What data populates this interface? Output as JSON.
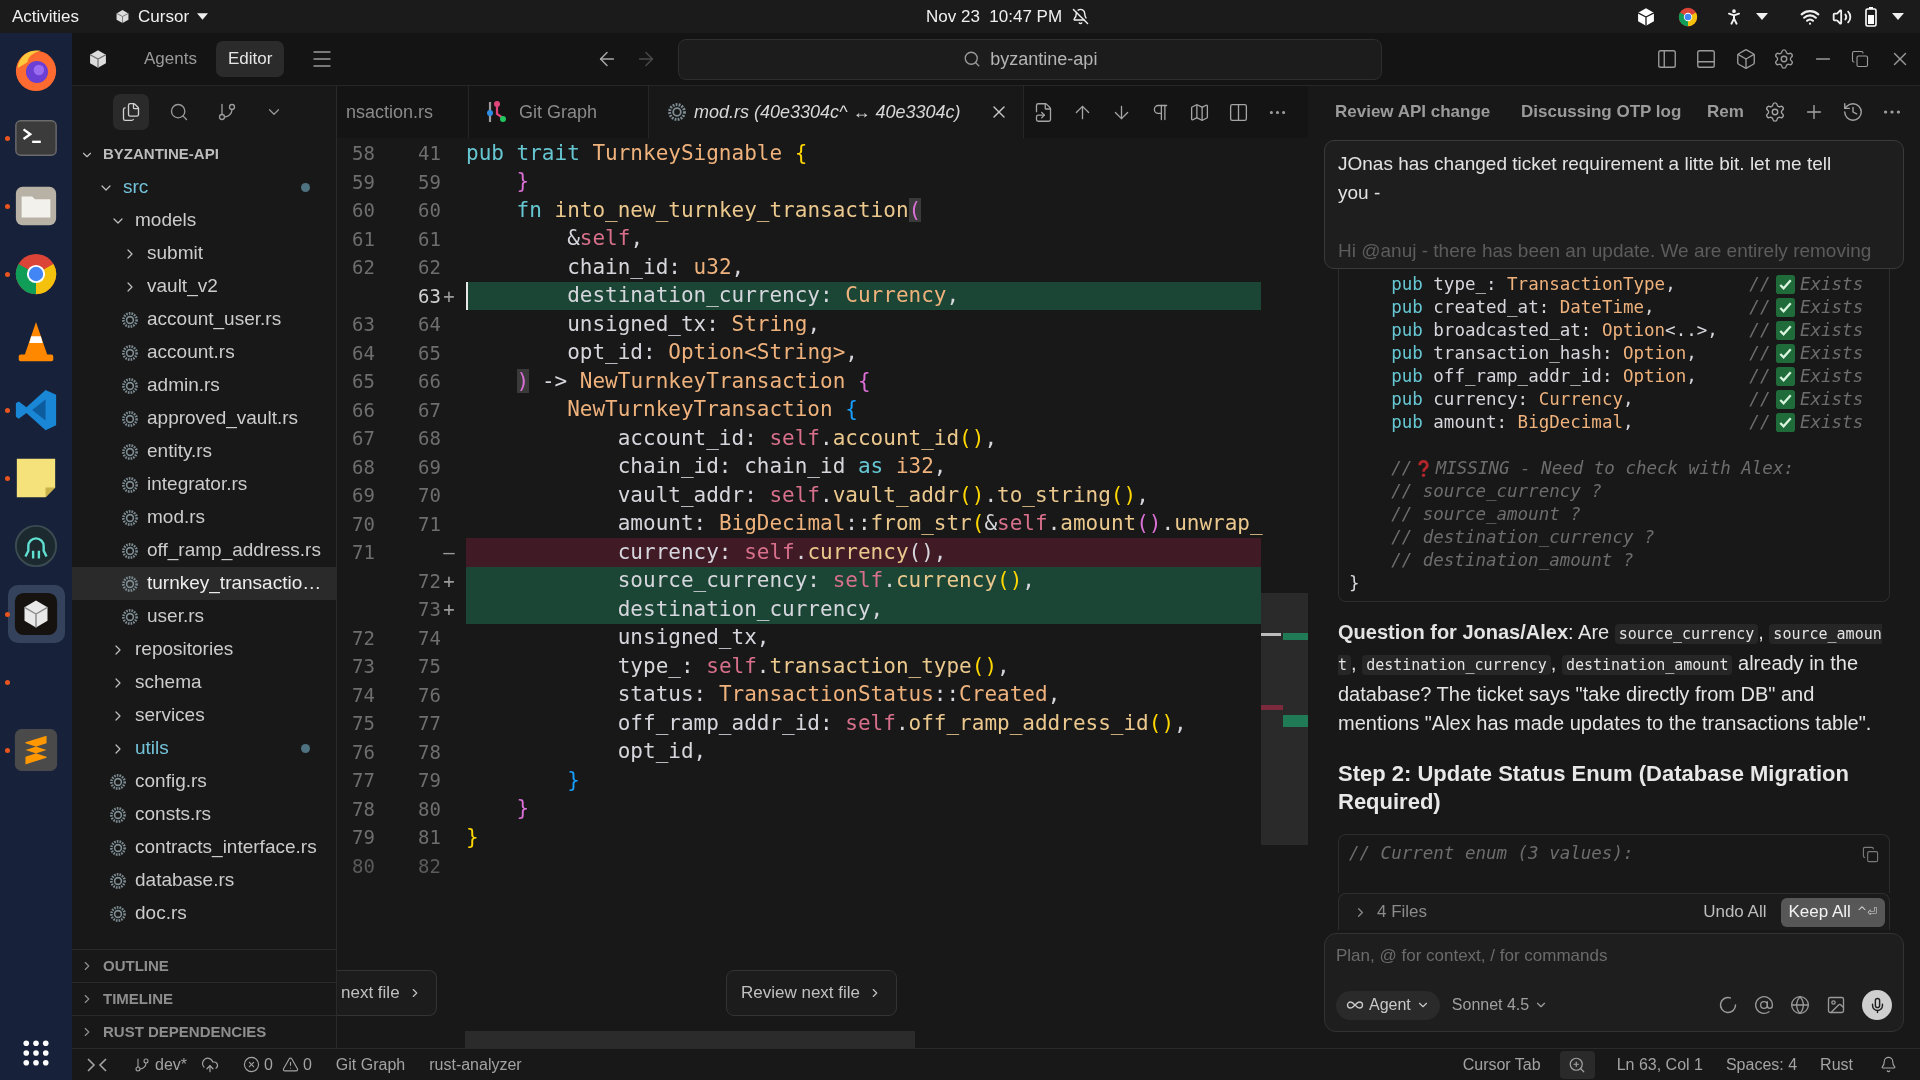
{
  "top_bar": {
    "activities": "Activities",
    "app_menu": "Cursor",
    "clock": "Nov 23  10:47 PM"
  },
  "dock": [
    {
      "kind": "firefox",
      "running": false,
      "selected": false
    },
    {
      "kind": "terminal",
      "running": true,
      "selected": false
    },
    {
      "kind": "files",
      "running": true,
      "selected": false
    },
    {
      "kind": "chrome",
      "running": true,
      "selected": false
    },
    {
      "kind": "vlc",
      "running": false,
      "selected": false
    },
    {
      "kind": "vscode",
      "running": true,
      "selected": false
    },
    {
      "kind": "notes",
      "running": true,
      "selected": false
    },
    {
      "kind": "gitkraken",
      "running": false,
      "selected": false
    },
    {
      "kind": "cursor",
      "running": true,
      "selected": true
    },
    {
      "kind": "blank",
      "running": true,
      "selected": false
    },
    {
      "kind": "sublime",
      "running": true,
      "selected": false
    }
  ],
  "title_bar": {
    "modes": [
      {
        "label": "Agents",
        "selected": false
      },
      {
        "label": "Editor",
        "selected": true
      }
    ],
    "nav": [
      {
        "kind": "back",
        "disabled": false
      },
      {
        "kind": "forward",
        "disabled": true
      }
    ],
    "command_center": {
      "value": "byzantine-api"
    }
  },
  "explorer": {
    "views": [
      {
        "kind": "files",
        "selected": true
      },
      {
        "kind": "search",
        "selected": false
      },
      {
        "kind": "source_control",
        "selected": false
      }
    ],
    "root": {
      "label": "BYZANTINE-API",
      "expanded": true
    },
    "tree": [
      {
        "kind": "folder",
        "label": "src",
        "expanded": true,
        "modified": true,
        "selected": false,
        "children": [
          {
            "kind": "folder",
            "label": "models",
            "expanded": true,
            "modified": false,
            "selected": false,
            "children": [
              {
                "kind": "folder",
                "label": "submit",
                "expanded": false,
                "modified": false,
                "selected": false
              },
              {
                "kind": "folder",
                "label": "vault_v2",
                "expanded": false,
                "modified": false,
                "selected": false
              },
              {
                "kind": "file",
                "label": "account_user.rs",
                "modified": false,
                "selected": false
              },
              {
                "kind": "file",
                "label": "account.rs",
                "modified": false,
                "selected": false
              },
              {
                "kind": "file",
                "label": "admin.rs",
                "modified": false,
                "selected": false
              },
              {
                "kind": "file",
                "label": "approved_vault.rs",
                "modified": false,
                "selected": false
              },
              {
                "kind": "file",
                "label": "entity.rs",
                "modified": false,
                "selected": false
              },
              {
                "kind": "file",
                "label": "integrator.rs",
                "modified": false,
                "selected": false
              },
              {
                "kind": "file",
                "label": "mod.rs",
                "modified": false,
                "selected": false
              },
              {
                "kind": "file",
                "label": "off_ramp_address.rs",
                "modified": false,
                "selected": false
              },
              {
                "kind": "file",
                "label": "turnkey_transactio…",
                "modified": false,
                "selected": true
              },
              {
                "kind": "file",
                "label": "user.rs",
                "modified": false,
                "selected": false
              }
            ]
          },
          {
            "kind": "folder",
            "label": "repositories",
            "expanded": false,
            "modified": false,
            "selected": false
          },
          {
            "kind": "folder",
            "label": "schema",
            "expanded": false,
            "modified": false,
            "selected": false
          },
          {
            "kind": "folder",
            "label": "services",
            "expanded": false,
            "modified": false,
            "selected": false
          },
          {
            "kind": "folder",
            "label": "utils",
            "expanded": false,
            "modified": true,
            "selected": false
          },
          {
            "kind": "file",
            "label": "config.rs",
            "modified": false,
            "selected": false
          },
          {
            "kind": "file",
            "label": "consts.rs",
            "modified": false,
            "selected": false
          },
          {
            "kind": "file",
            "label": "contracts_interface.rs",
            "modified": false,
            "selected": false
          },
          {
            "kind": "file",
            "label": "database.rs",
            "modified": false,
            "selected": false
          },
          {
            "kind": "file",
            "label": "doc.rs",
            "modified": false,
            "selected": false
          }
        ]
      }
    ],
    "sections": [
      {
        "label": "OUTLINE",
        "expanded": false
      },
      {
        "label": "TIMELINE",
        "expanded": false
      },
      {
        "label": "RUST DEPENDENCIES",
        "expanded": false
      }
    ]
  },
  "editor": {
    "tabs": [
      {
        "label": "nsaction.rs",
        "kind": "clipped",
        "selected": false
      },
      {
        "label": "Git Graph",
        "kind": "graph",
        "selected": false
      },
      {
        "label": "mod.rs (40e3304c^ ↔ 40e3304c)",
        "kind": "diff",
        "selected": true
      }
    ],
    "lines": [
      {
        "old": "58",
        "new": "41",
        "kind": "context",
        "current": false,
        "code": [
          {
            "text": "pub trait ",
            "kind": "kw"
          },
          {
            "text": "TurnkeySignable ",
            "kind": "ty"
          },
          {
            "text": "{",
            "kind": "y"
          }
        ]
      },
      {
        "old": "59",
        "new": "59",
        "kind": "context",
        "current": false,
        "code": [
          {
            "text": "    }",
            "kind": "m"
          }
        ]
      },
      {
        "old": "60",
        "new": "60",
        "kind": "context",
        "current": false,
        "code": [
          {
            "text": "    fn ",
            "kind": "kw"
          },
          {
            "text": "into_new_turnkey_transaction",
            "kind": "fn"
          },
          {
            "text": "(",
            "kind": "mb"
          }
        ]
      },
      {
        "old": "61",
        "new": "61",
        "kind": "context",
        "current": false,
        "code": [
          {
            "text": "        &",
            "kind": "p"
          },
          {
            "text": "self",
            "kind": "sf"
          },
          {
            "text": ",",
            "kind": "p"
          }
        ]
      },
      {
        "old": "62",
        "new": "62",
        "kind": "context",
        "current": false,
        "code": [
          {
            "text": "        chain_id: ",
            "kind": "p"
          },
          {
            "text": "u32",
            "kind": "ty"
          },
          {
            "text": ",",
            "kind": "p"
          }
        ]
      },
      {
        "new": "63",
        "marker": "+",
        "kind": "added",
        "current": true,
        "code": [
          {
            "text": "        destination_currency: ",
            "kind": "p"
          },
          {
            "text": "Currency",
            "kind": "ty"
          },
          {
            "text": ",",
            "kind": "p"
          }
        ]
      },
      {
        "old": "63",
        "new": "64",
        "kind": "context",
        "current": false,
        "code": [
          {
            "text": "        unsigned_tx: ",
            "kind": "p"
          },
          {
            "text": "String",
            "kind": "ty"
          },
          {
            "text": ",",
            "kind": "p"
          }
        ]
      },
      {
        "old": "64",
        "new": "65",
        "kind": "context",
        "current": false,
        "code": [
          {
            "text": "        opt_id: ",
            "kind": "p"
          },
          {
            "text": "Option<String>",
            "kind": "ty"
          },
          {
            "text": ",",
            "kind": "p"
          }
        ]
      },
      {
        "old": "65",
        "new": "66",
        "kind": "context",
        "current": false,
        "code": [
          {
            "text": "    )",
            "kind": "mb"
          },
          {
            "text": " -> ",
            "kind": "p"
          },
          {
            "text": "NewTurnkeyTransaction ",
            "kind": "ty"
          },
          {
            "text": "{",
            "kind": "m"
          }
        ]
      },
      {
        "old": "66",
        "new": "67",
        "kind": "context",
        "current": false,
        "code": [
          {
            "text": "        NewTurnkeyTransaction ",
            "kind": "ty"
          },
          {
            "text": "{",
            "kind": "b"
          }
        ]
      },
      {
        "old": "67",
        "new": "68",
        "kind": "context",
        "current": false,
        "code": [
          {
            "text": "            account_id: ",
            "kind": "p"
          },
          {
            "text": "self",
            "kind": "sf"
          },
          {
            "text": ".",
            "kind": "p"
          },
          {
            "text": "account_id",
            "kind": "fn"
          },
          {
            "text": "()",
            "kind": "y"
          },
          {
            "text": ",",
            "kind": "p"
          }
        ]
      },
      {
        "old": "68",
        "new": "69",
        "kind": "context",
        "current": false,
        "code": [
          {
            "text": "            chain_id: chain_id ",
            "kind": "p"
          },
          {
            "text": "as ",
            "kind": "kw"
          },
          {
            "text": "i32",
            "kind": "ty"
          },
          {
            "text": ",",
            "kind": "p"
          }
        ]
      },
      {
        "old": "69",
        "new": "70",
        "kind": "context",
        "current": false,
        "code": [
          {
            "text": "            vault_addr: ",
            "kind": "p"
          },
          {
            "text": "self",
            "kind": "sf"
          },
          {
            "text": ".",
            "kind": "p"
          },
          {
            "text": "vault_addr",
            "kind": "fn"
          },
          {
            "text": "()",
            "kind": "y"
          },
          {
            "text": ".",
            "kind": "p"
          },
          {
            "text": "to_string",
            "kind": "fn"
          },
          {
            "text": "()",
            "kind": "y"
          },
          {
            "text": ",",
            "kind": "p"
          }
        ]
      },
      {
        "old": "70",
        "new": "71",
        "kind": "context",
        "current": false,
        "code": [
          {
            "text": "            amount: ",
            "kind": "p"
          },
          {
            "text": "BigDecimal",
            "kind": "ty"
          },
          {
            "text": "::",
            "kind": "p"
          },
          {
            "text": "from_str",
            "kind": "fn"
          },
          {
            "text": "(",
            "kind": "y"
          },
          {
            "text": "&",
            "kind": "p"
          },
          {
            "text": "self",
            "kind": "sf"
          },
          {
            "text": ".",
            "kind": "p"
          },
          {
            "text": "amount",
            "kind": "fn"
          },
          {
            "text": "()",
            "kind": "m"
          },
          {
            "text": ".",
            "kind": "p"
          },
          {
            "text": "unwrap_",
            "kind": "fn"
          }
        ]
      },
      {
        "old": "71",
        "marker": "—",
        "kind": "removed",
        "current": false,
        "code": [
          {
            "text": "            currency: ",
            "kind": "p"
          },
          {
            "text": "self",
            "kind": "sf"
          },
          {
            "text": ".",
            "kind": "p"
          },
          {
            "text": "currency",
            "kind": "fn"
          },
          {
            "text": "(),",
            "kind": "p"
          }
        ]
      },
      {
        "new": "72",
        "marker": "+",
        "kind": "added",
        "current": false,
        "code": [
          {
            "text": "            source_currency: ",
            "kind": "p"
          },
          {
            "text": "self",
            "kind": "sf"
          },
          {
            "text": ".",
            "kind": "p"
          },
          {
            "text": "currency",
            "kind": "fn"
          },
          {
            "text": "()",
            "kind": "y"
          },
          {
            "text": ",",
            "kind": "p"
          }
        ]
      },
      {
        "new": "73",
        "marker": "+",
        "kind": "added",
        "current": false,
        "code": [
          {
            "text": "            destination_currency,",
            "kind": "p"
          }
        ]
      },
      {
        "old": "72",
        "new": "74",
        "kind": "context",
        "current": false,
        "code": [
          {
            "text": "            unsigned_tx,",
            "kind": "p"
          }
        ]
      },
      {
        "old": "73",
        "new": "75",
        "kind": "context",
        "current": false,
        "code": [
          {
            "text": "            type_: ",
            "kind": "p"
          },
          {
            "text": "self",
            "kind": "sf"
          },
          {
            "text": ".",
            "kind": "p"
          },
          {
            "text": "transaction_type",
            "kind": "fn"
          },
          {
            "text": "()",
            "kind": "y"
          },
          {
            "text": ",",
            "kind": "p"
          }
        ]
      },
      {
        "old": "74",
        "new": "76",
        "kind": "context",
        "current": false,
        "code": [
          {
            "text": "            status: ",
            "kind": "p"
          },
          {
            "text": "TransactionStatus",
            "kind": "ty"
          },
          {
            "text": "::",
            "kind": "p"
          },
          {
            "text": "Created",
            "kind": "ty"
          },
          {
            "text": ",",
            "kind": "p"
          }
        ]
      },
      {
        "old": "75",
        "new": "77",
        "kind": "context",
        "current": false,
        "code": [
          {
            "text": "            off_ramp_addr_id: ",
            "kind": "p"
          },
          {
            "text": "self",
            "kind": "sf"
          },
          {
            "text": ".",
            "kind": "p"
          },
          {
            "text": "off_ramp_address_id",
            "kind": "fn"
          },
          {
            "text": "()",
            "kind": "y"
          },
          {
            "text": ",",
            "kind": "p"
          }
        ]
      },
      {
        "old": "76",
        "new": "78",
        "kind": "context",
        "current": false,
        "code": [
          {
            "text": "            opt_id,",
            "kind": "p"
          }
        ]
      },
      {
        "old": "77",
        "new": "79",
        "kind": "context",
        "current": false,
        "code": [
          {
            "text": "        }",
            "kind": "b"
          }
        ]
      },
      {
        "old": "78",
        "new": "80",
        "kind": "context",
        "current": false,
        "code": [
          {
            "text": "    }",
            "kind": "m"
          }
        ]
      },
      {
        "old": "79",
        "new": "81",
        "kind": "context",
        "current": false,
        "code": [
          {
            "text": "}",
            "kind": "y"
          }
        ]
      },
      {
        "old": "80",
        "new": "82",
        "kind": "faded",
        "current": false
      }
    ],
    "buttons": [
      {
        "label": "next file"
      },
      {
        "label": "Review next file"
      }
    ]
  },
  "chat": {
    "tabs": [
      {
        "label": "Review API change",
        "selected": false
      },
      {
        "label": "Discussing OTP log",
        "selected": false
      },
      {
        "label": "Rem",
        "selected": false
      }
    ],
    "message": {
      "paragraphs": [
        {
          "text": "JOnas has changed ticket requirement a litte bit. let me tell you -",
          "cut": false
        },
        {
          "text": "Hi @anuj - there has been an update. We are entirely removing",
          "cut": true
        }
      ]
    },
    "code_block": {
      "lines": [
        {
          "kind": "checked",
          "code": [
            {
              "text": "    pub ",
              "kind": "kw"
            },
            {
              "text": "type_: ",
              "kind": "p"
            },
            {
              "text": "TransactionType",
              "kind": "ty"
            },
            {
              "text": ",",
              "kind": "p"
            }
          ],
          "prefix": "//",
          "note": "Exists"
        },
        {
          "kind": "checked",
          "code": [
            {
              "text": "    pub ",
              "kind": "kw"
            },
            {
              "text": "created_at: ",
              "kind": "p"
            },
            {
              "text": "DateTime",
              "kind": "ty"
            },
            {
              "text": ",",
              "kind": "p"
            }
          ],
          "prefix": "//",
          "note": "Exists"
        },
        {
          "kind": "checked",
          "code": [
            {
              "text": "    pub ",
              "kind": "kw"
            },
            {
              "text": "broadcasted_at: ",
              "kind": "p"
            },
            {
              "text": "Option",
              "kind": "ty"
            },
            {
              "text": "<..>,",
              "kind": "p"
            }
          ],
          "prefix": "//",
          "note": "Exists"
        },
        {
          "kind": "checked",
          "code": [
            {
              "text": "    pub ",
              "kind": "kw"
            },
            {
              "text": "transaction_hash: ",
              "kind": "p"
            },
            {
              "text": "Option",
              "kind": "ty"
            },
            {
              "text": ",",
              "kind": "p"
            }
          ],
          "prefix": "//",
          "note": "Exists"
        },
        {
          "kind": "checked",
          "code": [
            {
              "text": "    pub ",
              "kind": "kw"
            },
            {
              "text": "off_ramp_addr_id: ",
              "kind": "p"
            },
            {
              "text": "Option",
              "kind": "ty"
            },
            {
              "text": ",",
              "kind": "p"
            }
          ],
          "prefix": "//",
          "note": "Exists"
        },
        {
          "kind": "checked",
          "code": [
            {
              "text": "    pub ",
              "kind": "kw"
            },
            {
              "text": "currency: ",
              "kind": "p"
            },
            {
              "text": "Currency",
              "kind": "ty"
            },
            {
              "text": ",",
              "kind": "p"
            }
          ],
          "prefix": "//",
          "note": "Exists"
        },
        {
          "kind": "checked",
          "code": [
            {
              "text": "    pub ",
              "kind": "kw"
            },
            {
              "text": "amount: ",
              "kind": "p"
            },
            {
              "text": "BigDecimal",
              "kind": "ty"
            },
            {
              "text": ",",
              "kind": "p"
            }
          ],
          "prefix": "//",
          "note": "Exists"
        },
        {
          "kind": "blank"
        },
        {
          "kind": "flagged",
          "prefix": "    //",
          "note": "MISSING - Need to check with Alex:"
        },
        {
          "kind": "comment",
          "text": "    // source_currency ?"
        },
        {
          "kind": "comment",
          "text": "    // source_amount ?"
        },
        {
          "kind": "comment",
          "text": "    // destination_currency ?"
        },
        {
          "kind": "comment",
          "text": "    // destination_amount ?"
        },
        {
          "kind": "code",
          "code": [
            {
              "text": "}",
              "kind": "p"
            }
          ]
        }
      ]
    },
    "question": [
      {
        "kind": "bold",
        "text": "Question for Jonas/Alex"
      },
      {
        "kind": "text",
        "text": ": Are "
      },
      {
        "kind": "code",
        "text": "source_currency"
      },
      {
        "kind": "text",
        "text": ", "
      },
      {
        "kind": "code",
        "text": "source_amount"
      },
      {
        "kind": "text",
        "text": ", "
      },
      {
        "kind": "code",
        "text": "destination_currency"
      },
      {
        "kind": "text",
        "text": ", "
      },
      {
        "kind": "code",
        "text": "destination_amount"
      },
      {
        "kind": "text",
        "text": " already in the database? The ticket says \"take directly from DB\" and mentions \"Alex has made updates to the transactions table\"."
      }
    ],
    "heading": "Step 2: Update Status Enum (Database Migration Required)",
    "code_block_2": {
      "lines": [
        {
          "kind": "comment",
          "text": "// Current enum (3 values):"
        }
      ]
    },
    "changes_bar": {
      "expanded": false,
      "files": "4 Files",
      "undo": "Undo All",
      "keep": "Keep All",
      "shortcut": "^⏎"
    },
    "composer": {
      "placeholder": "Plan, @ for context, / for commands",
      "mode": "Agent",
      "model": "Sonnet 4.5"
    }
  },
  "status_bar": {
    "branch": "dev*",
    "errors": "0",
    "warnings": "0",
    "items_left": [
      "Git Graph",
      "rust-analyzer"
    ],
    "cursor_tab": "Cursor Tab",
    "position": "Ln 63, Col 1",
    "indentation": "Spaces: 4",
    "language": "Rust"
  }
}
